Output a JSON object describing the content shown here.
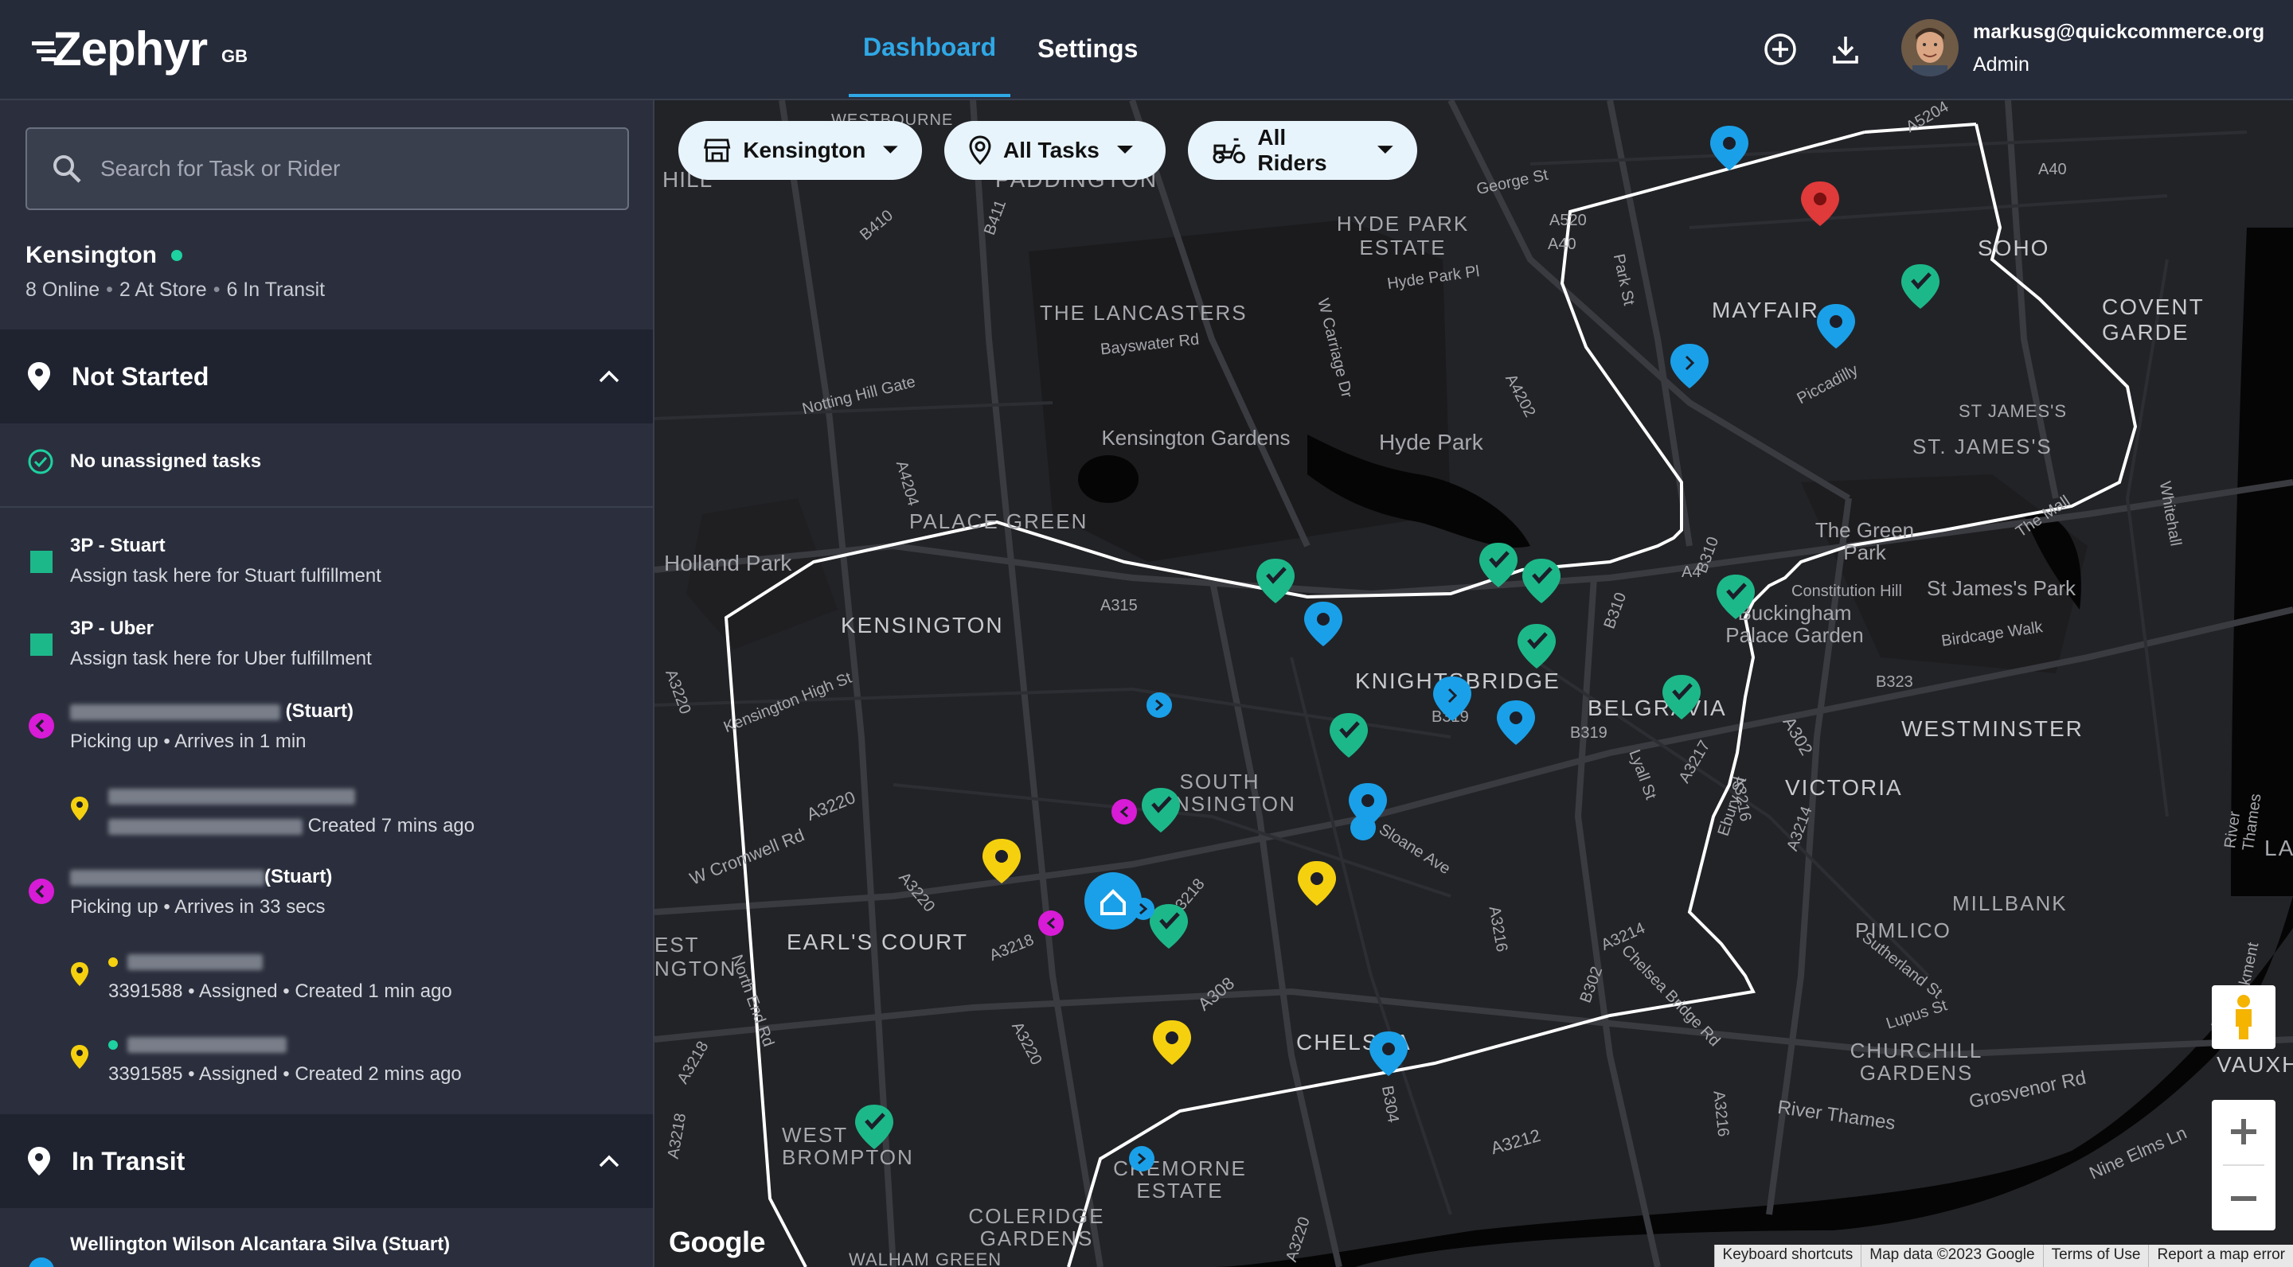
{
  "header": {
    "logo": "Zephyr",
    "region": "GB",
    "tabs": [
      {
        "label": "Dashboard",
        "active": true
      },
      {
        "label": "Settings",
        "active": false
      }
    ],
    "user_email": "markusg@quickcommerce.org",
    "user_role": "Admin"
  },
  "sidebar": {
    "search_placeholder": "Search for Task or Rider",
    "store": {
      "name": "Kensington",
      "online": "8 Online",
      "at_store": "2 At Store",
      "in_transit": "6 In Transit"
    },
    "not_started": {
      "title": "Not Started",
      "no_tasks": "No unassigned tasks",
      "items": [
        {
          "title": "3P - Stuart",
          "subtitle": "Assign task here for Stuart fulfillment"
        },
        {
          "title": "3P - Uber",
          "subtitle": "Assign task here for Uber fulfillment"
        }
      ],
      "riders": [
        {
          "name_suffix": "(Stuart)",
          "status": "Picking up • Arrives in 1 min",
          "task_sub": "Created 7 mins ago"
        },
        {
          "name_suffix": "(Stuart)",
          "status": "Picking up • Arrives in 33 secs",
          "tasks": [
            {
              "sub": "3391588 • Assigned • Created 1 min ago"
            },
            {
              "sub": "3391585 • Assigned • Created 2 mins ago"
            }
          ]
        }
      ]
    },
    "in_transit": {
      "title": "In Transit",
      "first_rider": "Wellington Wilson Alcantara Silva (Stuart)"
    }
  },
  "map": {
    "filters": [
      {
        "label": "Kensington",
        "icon": "store-icon"
      },
      {
        "label": "All Tasks",
        "icon": "location-pin-icon"
      },
      {
        "label": "All Riders",
        "icon": "scooter-icon"
      }
    ],
    "labels": {
      "westbourne": "WESTBOURNE",
      "hill": "HILL",
      "paddington": "PADDINGTON",
      "hyde_park_estate": "HYDE PARK ESTATE",
      "the_lancasters": "THE LANCASTERS",
      "kensington_gardens": "Kensington Gardens",
      "hyde_park": "Hyde Park",
      "palace_green": "PALACE GREEN",
      "holland_park": "Holland Park",
      "kensington": "KENSINGTON",
      "knightsbridge": "KNIGHTSBRIDGE",
      "belgravia": "BELGRAVIA",
      "south_kensington": "SOUTH KENSINGTON",
      "earls_court": "EARL'S COURT",
      "west_kensington": "EST NGTON",
      "chelsea": "CHELSEA",
      "west_brompton": "WEST BROMPTON",
      "cremorne_estate": "CREMORNE ESTATE",
      "coleridge_gardens": "COLERIDGE GARDENS",
      "walham_green": "WALHAM GREEN",
      "mayfair": "MAYFAIR",
      "soho": "SOHO",
      "covent_garden": "COVENT GARDE",
      "st_james": "ST. JAMES'S",
      "st_jamess_small": "ST JAMES'S",
      "green_park": "The Green Park",
      "st_james_park": "St James's Park",
      "buckingham": "Buckingham Palace Garden",
      "westminster": "WESTMINSTER",
      "victoria": "VICTORIA",
      "millbank": "MILLBANK",
      "pimlico": "PIMLICO",
      "churchill_gardens": "CHURCHILL GARDENS",
      "vauxhall": "VAUXHAL",
      "lambeth": "LA",
      "river_thames": "River Thames",
      "roads": {
        "a4": "A4",
        "a315": "A315",
        "a3220": "A3220",
        "a3218": "A3218",
        "a308": "A308",
        "a3212": "A3212",
        "a3216": "A3216",
        "a3217": "A3217",
        "a3214": "A3214",
        "a4202": "A4202",
        "a4204": "A4204",
        "a40": "A40",
        "a5204": "A5204",
        "a520": "A520",
        "a302": "A302",
        "b319": "B319",
        "b310": "B310",
        "b304": "B304",
        "b302": "B302",
        "b323": "B323",
        "b411": "B411",
        "b410": "B410",
        "bayswater_rd": "Bayswater Rd",
        "notting_hill_gate": "Notting Hill Gate",
        "hyde_park_pl": "Hyde Park Pl",
        "w_carriage_dr": "W Carriage Dr",
        "kensington_high_st": "Kensington High St",
        "w_cromwell_rd": "W Cromwell Rd",
        "sloane_ave": "Sloane Ave",
        "piccadilly": "Piccadilly",
        "ebury_st": "Ebury St",
        "chelsea_bridge_rd": "Chelsea Bridge Rd",
        "grosvenor_rd": "Grosvenor Rd",
        "nine_elms": "Nine Elms Ln",
        "lyall_st": "Lyall St",
        "constitution_hill": "Constitution Hill",
        "the_mall": "The Mall",
        "whitehall": "Whitehall",
        "george_st": "George St",
        "park_st": "Park St",
        "birdcage_walk": "Birdcage Walk",
        "lupus_st": "Lupus St",
        "sutherland_st": "Sutherland St",
        "north_end_rd": "North End Rd",
        "albert_embankment": "Albert Embankment",
        "river_thames_vertical": "River Thames"
      }
    },
    "attribution": {
      "google": "Google",
      "shortcuts": "Keyboard shortcuts",
      "data": "Map data ©2023 Google",
      "terms": "Terms of Use",
      "report": "Report a map error"
    },
    "colors": {
      "map_bg": "#222327",
      "park": "#1c1c1e",
      "water": "#050505",
      "zone": "#ffffff",
      "rider_blue": "#1aa0e8",
      "task_green": "#1db88a",
      "task_yellow": "#f5d00f",
      "task_red": "#e03a3a",
      "rider_magenta": "#d81bd6"
    }
  }
}
